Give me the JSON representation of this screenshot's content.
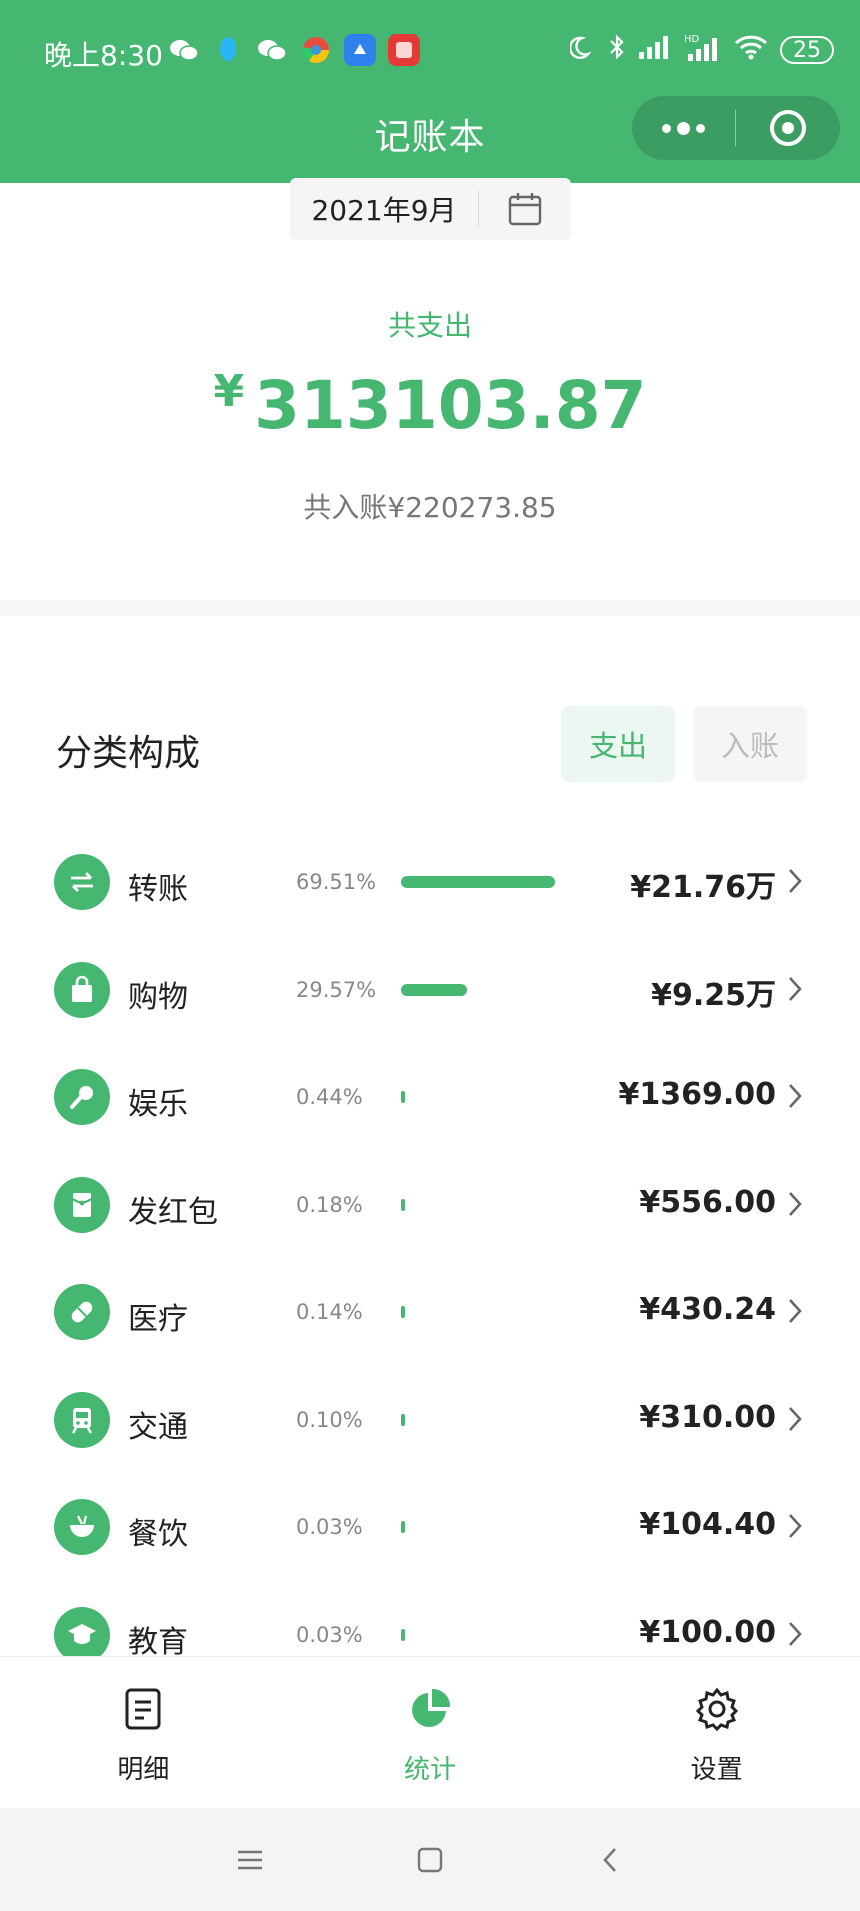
{
  "status_bar": {
    "time": "晚上8:30",
    "battery": "25",
    "hd": "HD"
  },
  "header": {
    "title": "记账本"
  },
  "date_picker": {
    "value": "2021年9月"
  },
  "summary": {
    "expense_label": "共支出",
    "currency": "¥",
    "expense_total": "313103.87",
    "income_text": "共入账¥220273.85"
  },
  "category_section": {
    "title": "分类构成",
    "toggle_expense": "支出",
    "toggle_income": "入账"
  },
  "categories": [
    {
      "name": "转账",
      "percent_text": "69.51%",
      "percent": 69.51,
      "amount": "¥21.76万",
      "icon": "transfer-icon"
    },
    {
      "name": "购物",
      "percent_text": "29.57%",
      "percent": 29.57,
      "amount": "¥9.25万",
      "icon": "shopping-bag-icon"
    },
    {
      "name": "娱乐",
      "percent_text": "0.44%",
      "percent": 0.44,
      "amount": "¥1369.00",
      "icon": "microphone-icon"
    },
    {
      "name": "发红包",
      "percent_text": "0.18%",
      "percent": 0.18,
      "amount": "¥556.00",
      "icon": "red-envelope-icon"
    },
    {
      "name": "医疗",
      "percent_text": "0.14%",
      "percent": 0.14,
      "amount": "¥430.24",
      "icon": "pill-icon"
    },
    {
      "name": "交通",
      "percent_text": "0.10%",
      "percent": 0.1,
      "amount": "¥310.00",
      "icon": "train-icon"
    },
    {
      "name": "餐饮",
      "percent_text": "0.03%",
      "percent": 0.03,
      "amount": "¥104.40",
      "icon": "bowl-icon"
    },
    {
      "name": "教育",
      "percent_text": "0.03%",
      "percent": 0.03,
      "amount": "¥100.00",
      "icon": "graduation-cap-icon"
    }
  ],
  "tabbar": {
    "items": [
      {
        "label": "明细",
        "icon": "document-icon",
        "active": false
      },
      {
        "label": "统计",
        "icon": "pie-chart-icon",
        "active": true
      },
      {
        "label": "设置",
        "icon": "gear-icon",
        "active": false
      }
    ]
  },
  "colors": {
    "brand": "#45b771",
    "text": "#222222",
    "muted": "#888888"
  }
}
